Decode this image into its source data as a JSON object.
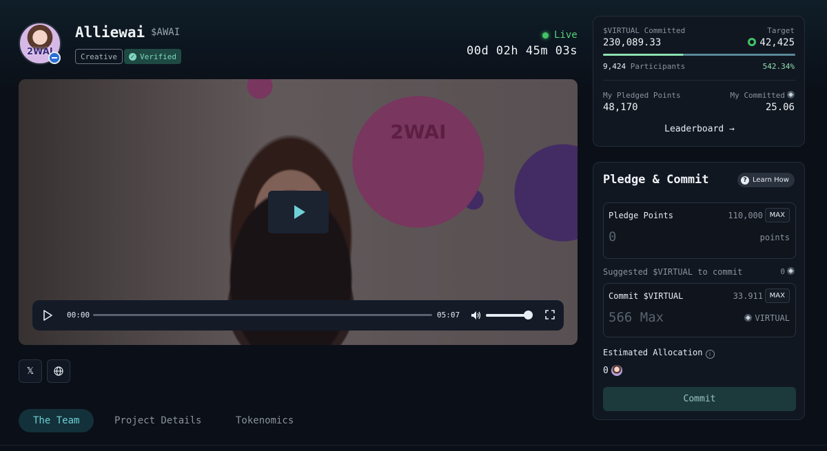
{
  "project": {
    "name": "Alliewai",
    "ticker": "$AWAI",
    "avatar_text": "2WAI",
    "tags": [
      "Creative",
      "Verified"
    ]
  },
  "status": {
    "live_label": "Live",
    "countdown": "00d 02h 45m 03s"
  },
  "video": {
    "logo_text": "2WAI",
    "current_time": "00:00",
    "total_time": "05:07",
    "progress": 0,
    "volume": 0.9
  },
  "social": {
    "x_icon": "𝕏",
    "web_icon": "🌐"
  },
  "tabs": [
    {
      "label": "The Team",
      "active": true
    },
    {
      "label": "Project Details",
      "active": false
    },
    {
      "label": "Tokenomics",
      "active": false
    }
  ],
  "stats": {
    "committed_label": "$VIRTUAL Committed",
    "committed_value": "230,089.33",
    "target_label": "Target",
    "target_value": "42,425",
    "participants_count": "9,424",
    "participants_label": "Participants",
    "percent": "542.34%",
    "progress_fraction": 0.42,
    "pledged_label": "My Pledged Points",
    "pledged_value": "48,170",
    "my_committed_label": "My Committed",
    "my_committed_value": "25.06",
    "leaderboard_label": "Leaderboard →"
  },
  "pledge": {
    "title": "Pledge & Commit",
    "learn_how": "Learn How",
    "points_label": "Pledge Points",
    "points_max_value": "110,000",
    "max_label": "MAX",
    "points_input": "0",
    "points_unit": "points",
    "suggested_label": "Suggested $VIRTUAL to commit",
    "suggested_value": "0",
    "commit_label": "Commit $VIRTUAL",
    "commit_max_value": "33.911",
    "commit_input": "566 Max",
    "commit_unit": "VIRTUAL",
    "est_label": "Estimated Allocation",
    "est_value": "0",
    "commit_button": "Commit"
  },
  "colors": {
    "accent": "#6fd0d6",
    "live": "#44c266",
    "background": "#0b0f17"
  }
}
